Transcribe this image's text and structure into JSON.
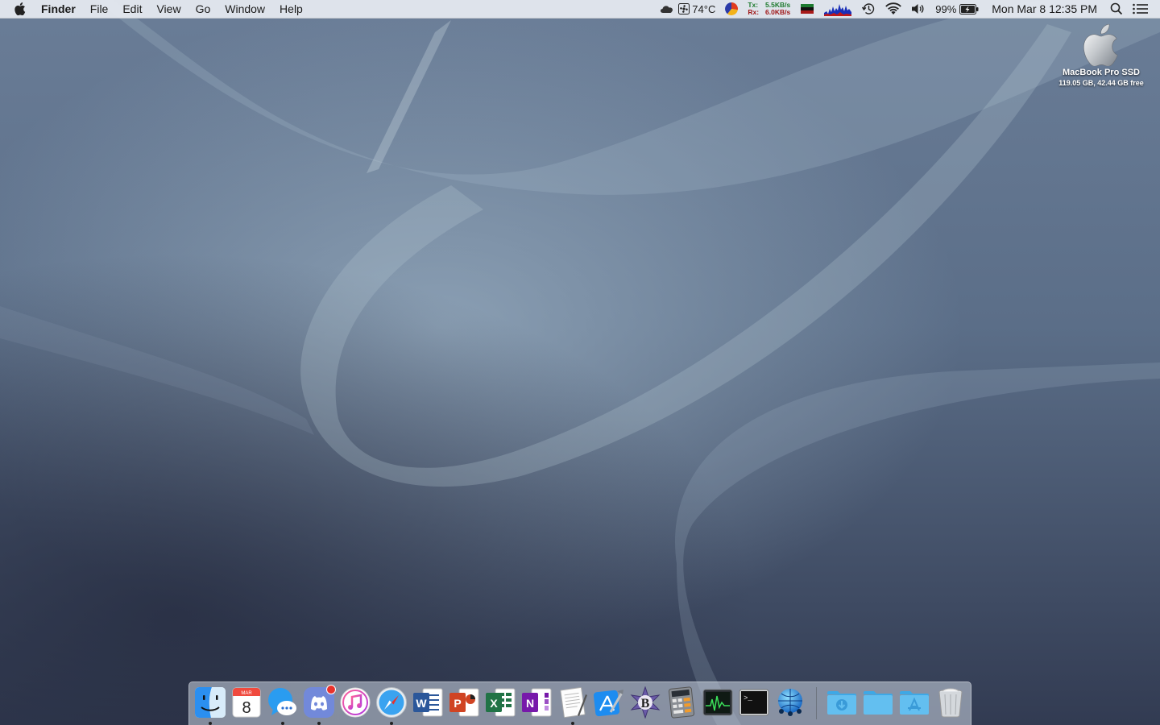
{
  "menubar": {
    "app_name": "Finder",
    "menus": [
      "File",
      "Edit",
      "View",
      "Go",
      "Window",
      "Help"
    ],
    "status": {
      "temperature": "74°C",
      "tx_label": "Tx:",
      "tx_rate": "5.5KB/s",
      "rx_label": "Rx:",
      "rx_rate": "6.0KB/s",
      "battery": "99%",
      "datetime": "Mon Mar 8  12:35 PM"
    }
  },
  "desktop": {
    "drive_name": "MacBook Pro SSD",
    "drive_info": "119.05 GB, 42.44 GB free"
  },
  "dock": {
    "calendar_month": "MAR",
    "calendar_day": "8",
    "apps": [
      {
        "name": "finder-icon",
        "running": true
      },
      {
        "name": "calendar-icon",
        "running": false
      },
      {
        "name": "messenger-icon",
        "running": true
      },
      {
        "name": "discord-icon",
        "running": true,
        "badge": true
      },
      {
        "name": "itunes-icon",
        "running": false
      },
      {
        "name": "safari-icon",
        "running": true
      },
      {
        "name": "word-icon",
        "running": false
      },
      {
        "name": "powerpoint-icon",
        "running": false
      },
      {
        "name": "excel-icon",
        "running": false
      },
      {
        "name": "onenote-icon",
        "running": false
      },
      {
        "name": "textedit-icon",
        "running": true
      },
      {
        "name": "xcode-icon",
        "running": false
      },
      {
        "name": "bbedit-icon",
        "running": false
      },
      {
        "name": "calculator-icon",
        "running": false
      },
      {
        "name": "activity-monitor-icon",
        "running": false
      },
      {
        "name": "terminal-icon",
        "running": false
      },
      {
        "name": "network-app-icon",
        "running": false
      }
    ],
    "stacks": [
      "downloads-folder-icon",
      "documents-folder-icon",
      "applications-folder-icon",
      "trash-icon"
    ]
  },
  "colors": {
    "menubar_bg": "#e8ecf2",
    "wallpaper_base": "#4a5a72",
    "badge_red": "#e8322c"
  }
}
